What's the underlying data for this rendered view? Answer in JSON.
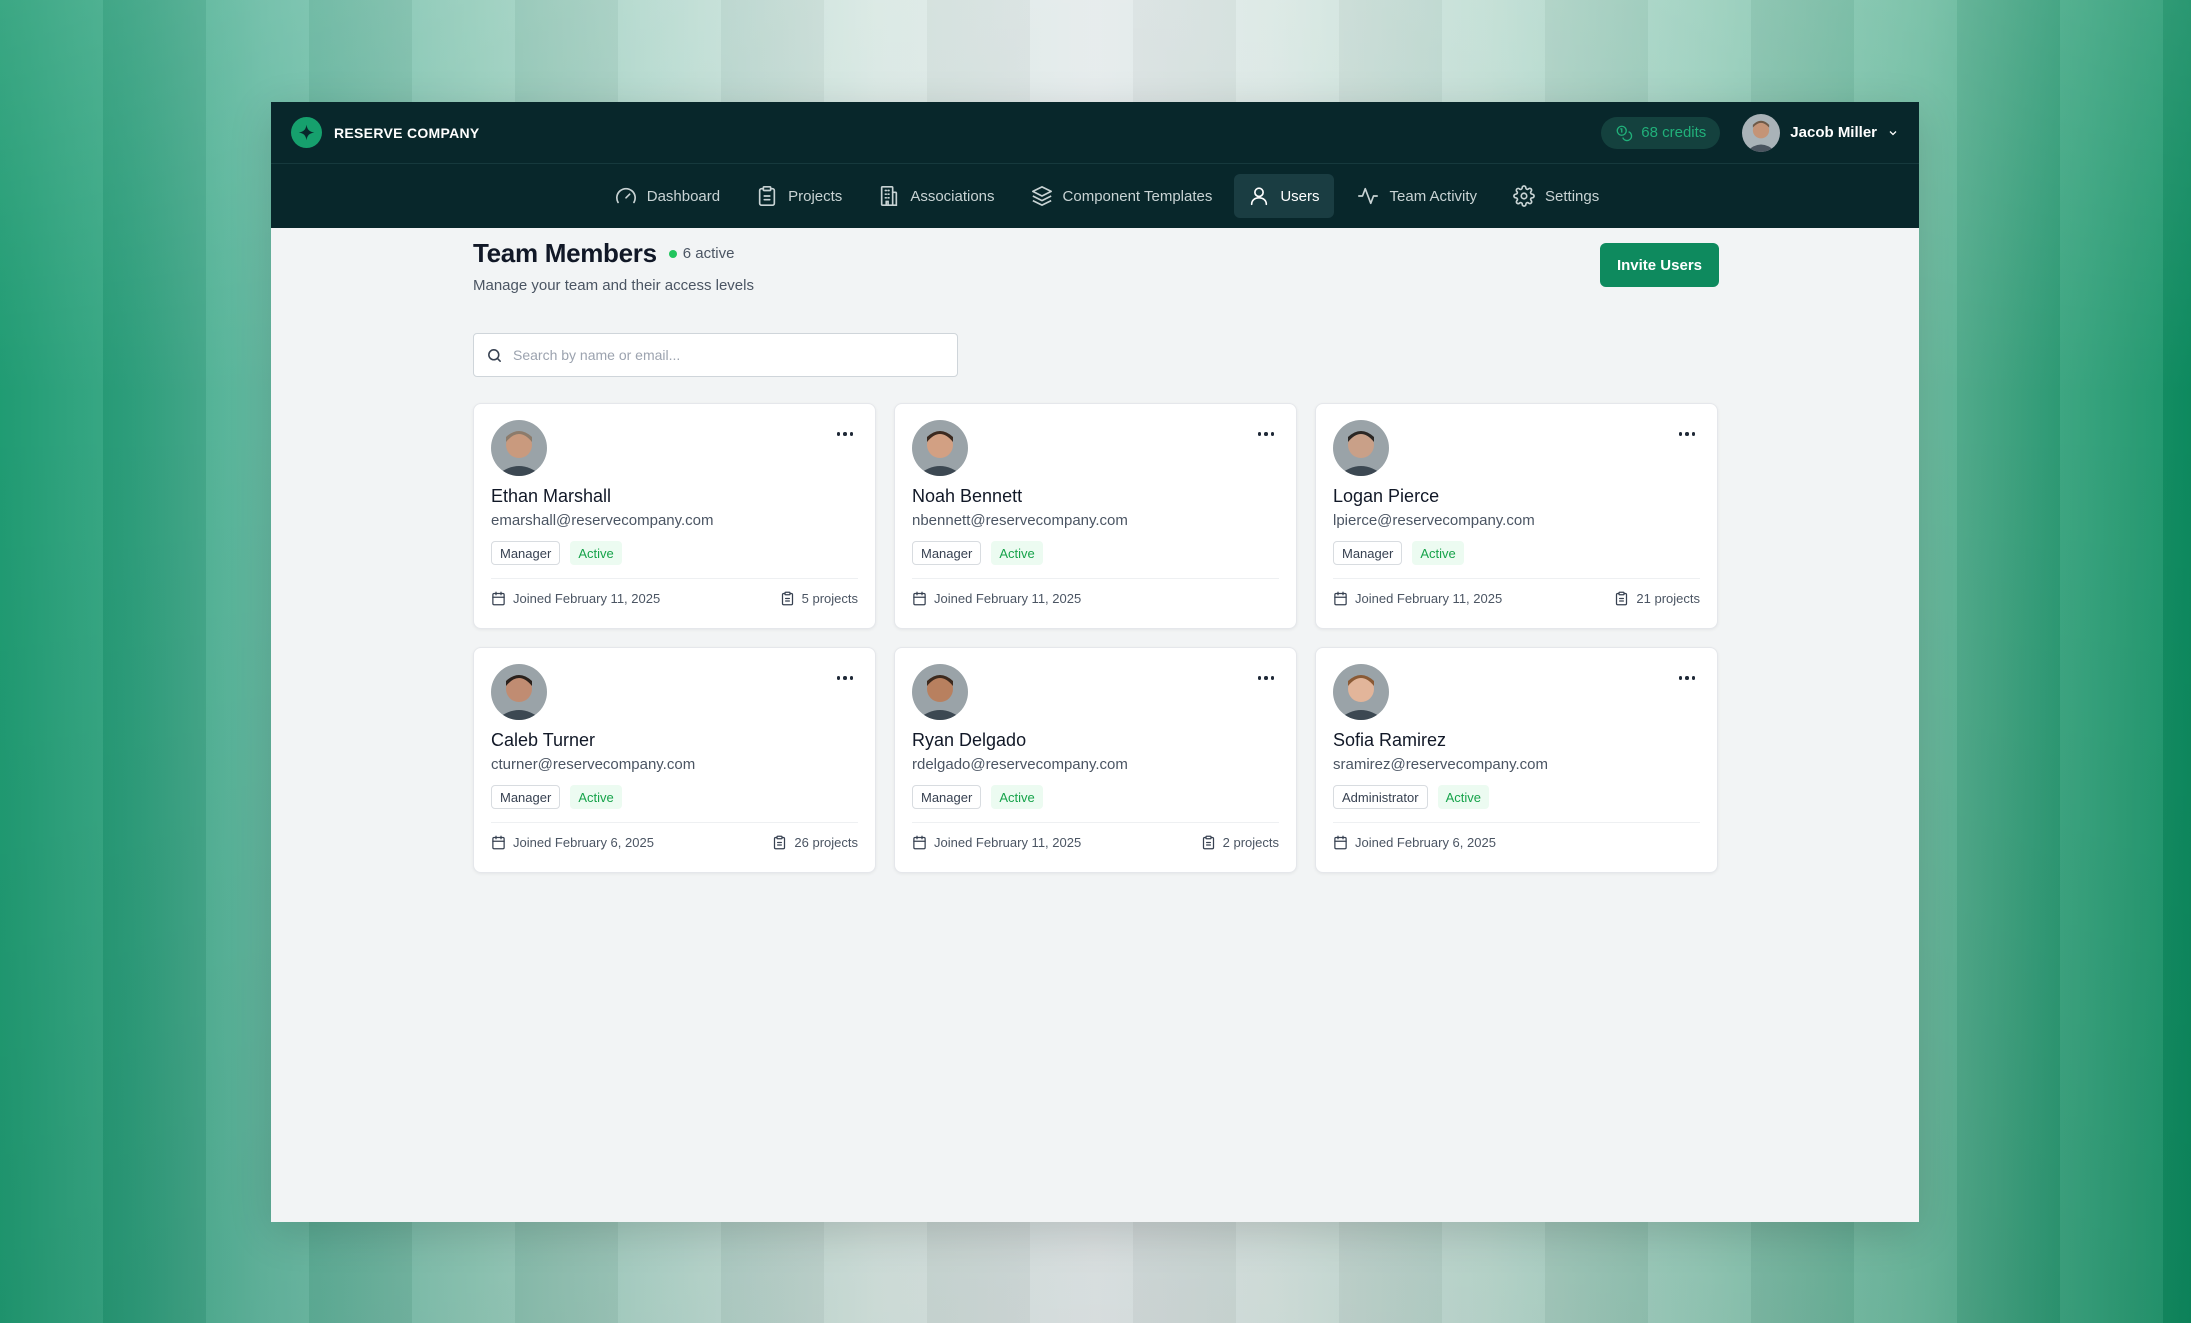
{
  "brand": {
    "name": "RESERVE COMPANY"
  },
  "header": {
    "credits": "68 credits",
    "user_name": "Jacob Miller"
  },
  "nav": {
    "items": [
      {
        "label": "Dashboard",
        "icon": "gauge-icon"
      },
      {
        "label": "Projects",
        "icon": "clipboard-icon"
      },
      {
        "label": "Associations",
        "icon": "building-icon"
      },
      {
        "label": "Component Templates",
        "icon": "layers-icon"
      },
      {
        "label": "Users",
        "icon": "user-icon",
        "active": true
      },
      {
        "label": "Team Activity",
        "icon": "activity-icon"
      },
      {
        "label": "Settings",
        "icon": "gear-icon"
      }
    ]
  },
  "page": {
    "title": "Team Members",
    "active_count": "6 active",
    "subtitle": "Manage your team and their access levels",
    "invite_label": "Invite Users",
    "search_placeholder": "Search by name or email..."
  },
  "members": [
    {
      "name": "Ethan Marshall",
      "email": "emarshall@reservecompany.com",
      "role": "Manager",
      "status": "Active",
      "joined": "Joined February 11, 2025",
      "projects": "5 projects",
      "skin": "#c99a7e",
      "hair": "#8c7b6b"
    },
    {
      "name": "Noah Bennett",
      "email": "nbennett@reservecompany.com",
      "role": "Manager",
      "status": "Active",
      "joined": "Joined February 11, 2025",
      "projects": "",
      "skin": "#d2a083",
      "hair": "#3b2a20"
    },
    {
      "name": "Logan Pierce",
      "email": "lpierce@reservecompany.com",
      "role": "Manager",
      "status": "Active",
      "joined": "Joined February 11, 2025",
      "projects": "21 projects",
      "skin": "#c9a088",
      "hair": "#2b2724"
    },
    {
      "name": "Caleb Turner",
      "email": "cturner@reservecompany.com",
      "role": "Manager",
      "status": "Active",
      "joined": "Joined February 6, 2025",
      "projects": "26 projects",
      "skin": "#c08c72",
      "hair": "#2a211c"
    },
    {
      "name": "Ryan Delgado",
      "email": "rdelgado@reservecompany.com",
      "role": "Manager",
      "status": "Active",
      "joined": "Joined February 11, 2025",
      "projects": "2 projects",
      "skin": "#b8805f",
      "hair": "#3d2a1e"
    },
    {
      "name": "Sofia Ramirez",
      "email": "sramirez@reservecompany.com",
      "role": "Administrator",
      "status": "Active",
      "joined": "Joined February 6, 2025",
      "projects": "",
      "skin": "#e2b59a",
      "hair": "#8a5a35"
    }
  ]
}
